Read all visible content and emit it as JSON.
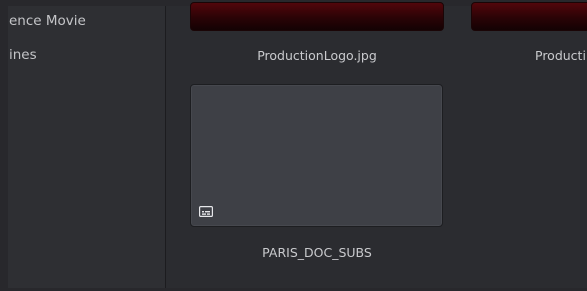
{
  "sidebar": {
    "items": [
      {
        "label": "ence Movie"
      },
      {
        "label": "ines"
      }
    ]
  },
  "media_pool": {
    "clips": [
      {
        "name": "ProductionLogo.jpg",
        "thumbnail": "red-gradient"
      },
      {
        "name": "Producti",
        "thumbnail": "red-gradient"
      },
      {
        "name": "PARIS_DOC_SUBS",
        "thumbnail": "empty",
        "badge_icon": "subtitle-icon"
      }
    ]
  },
  "colors": {
    "background": "#28282c",
    "sidebar": "#2e2f33",
    "thumbnail_red": "#52060b",
    "thumbnail_empty": "#3e4046",
    "text": "#c9cacd"
  }
}
